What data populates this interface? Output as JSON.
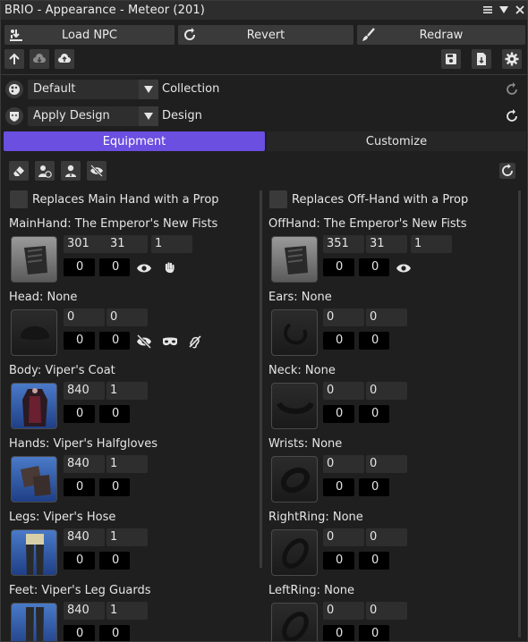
{
  "window": {
    "title": "BRIO - Appearance - Meteor (201)",
    "titlebar_icons": [
      "menu-icon",
      "collapse-icon",
      "close-icon"
    ]
  },
  "toolbar": {
    "load_npc_label": "Load NPC",
    "revert_label": "Revert",
    "redraw_label": "Redraw"
  },
  "collection": {
    "value": "Default",
    "label": "Collection"
  },
  "design": {
    "value": "Apply Design",
    "label": "Design"
  },
  "tabs": [
    {
      "label": "Equipment",
      "active": true
    },
    {
      "label": "Customize",
      "active": false
    }
  ],
  "equipment": {
    "left_prop_label": "Replaces Main Hand with a Prop",
    "right_prop_label": "Replaces Off-Hand with a Prop",
    "left": [
      {
        "title": "MainHand: The Emperor's New Fists",
        "v1": "301",
        "v2": "31",
        "v3": "1",
        "dye1": "0",
        "dye2": "0",
        "thumb": "gray"
      },
      {
        "title": "Head: None",
        "v1": "0",
        "v2": "0",
        "dye1": "0",
        "dye2": "0",
        "thumb": "empty"
      },
      {
        "title": "Body: Viper's Coat",
        "v1": "840",
        "v2": "1",
        "dye1": "0",
        "dye2": "0",
        "thumb": "blue"
      },
      {
        "title": "Hands: Viper's Halfgloves",
        "v1": "840",
        "v2": "1",
        "dye1": "0",
        "dye2": "0",
        "thumb": "blue"
      },
      {
        "title": "Legs: Viper's Hose",
        "v1": "840",
        "v2": "1",
        "dye1": "0",
        "dye2": "0",
        "thumb": "blue"
      },
      {
        "title": "Feet: Viper's Leg Guards",
        "v1": "840",
        "v2": "1",
        "dye1": "0",
        "dye2": "0",
        "thumb": "blue"
      }
    ],
    "right": [
      {
        "title": "OffHand: The Emperor's New Fists",
        "v1": "351",
        "v2": "31",
        "v3": "1",
        "dye1": "0",
        "dye2": "0",
        "thumb": "gray"
      },
      {
        "title": "Ears: None",
        "v1": "0",
        "v2": "0",
        "dye1": "0",
        "dye2": "0",
        "thumb": "empty"
      },
      {
        "title": "Neck: None",
        "v1": "0",
        "v2": "0",
        "dye1": "0",
        "dye2": "0",
        "thumb": "empty"
      },
      {
        "title": "Wrists: None",
        "v1": "0",
        "v2": "0",
        "dye1": "0",
        "dye2": "0",
        "thumb": "empty"
      },
      {
        "title": "RightRing: None",
        "v1": "0",
        "v2": "0",
        "dye1": "0",
        "dye2": "0",
        "thumb": "empty"
      },
      {
        "title": "LeftRing: None",
        "v1": "0",
        "v2": "0",
        "dye1": "0",
        "dye2": "0",
        "thumb": "empty"
      }
    ]
  },
  "colors": {
    "accent": "#6a4fe0",
    "background": "#1f1f1f",
    "button": "#3a3a3a"
  }
}
